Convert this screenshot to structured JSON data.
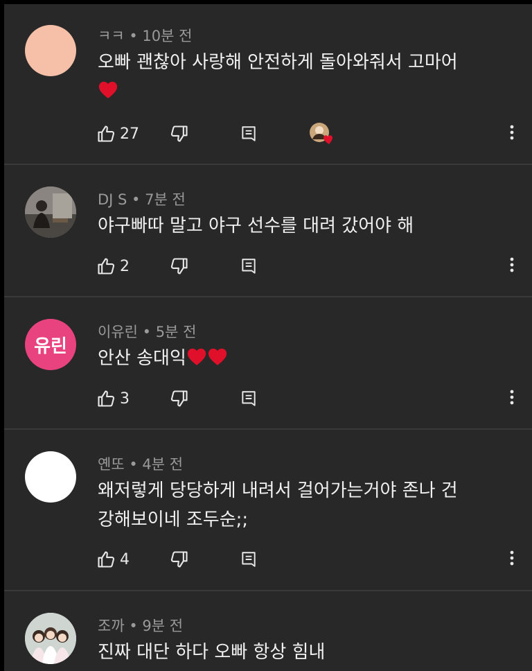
{
  "comments": [
    {
      "author": "ㅋㅋ",
      "time": "10분 전",
      "text": "오빠 괜찮아 사랑해 안전하게 돌아와줘서 고마어",
      "emoji": [
        "heart"
      ],
      "likes": "27",
      "avatar": {
        "kind": "solid",
        "color": "#f5bfa8"
      },
      "creator_heart": true
    },
    {
      "author": "DJ S",
      "time": "7분 전",
      "text": "야구빠따 말고 야구 선수를 대려 갔어야 해",
      "emoji": [],
      "likes": "2",
      "avatar": {
        "kind": "photo"
      },
      "creator_heart": false
    },
    {
      "author": "이유린",
      "time": "5분 전",
      "text": "안산 송대익",
      "emoji": [
        "heart",
        "heart"
      ],
      "likes": "3",
      "avatar": {
        "kind": "initials",
        "initials": "유린",
        "color": "#e8437f"
      },
      "creator_heart": false
    },
    {
      "author": "옌또",
      "time": "4분 전",
      "text": "왜저렇게 당당하게 내려서 걸어가는거야 존나 건강해보이네 조두순;;",
      "emoji": [],
      "likes": "4",
      "avatar": {
        "kind": "solid",
        "color": "#ffffff"
      },
      "creator_heart": false
    },
    {
      "author": "조까",
      "time": "9분 전",
      "text": "진짜 대단 하다 오빠 항상 힘내",
      "emoji": [],
      "likes": "",
      "avatar": {
        "kind": "photo"
      },
      "creator_heart": false
    }
  ],
  "meta_separator": " • ",
  "icons": {
    "like": "thumb-up-icon",
    "dislike": "thumb-down-icon",
    "reply": "reply-icon",
    "more": "more-vert-icon",
    "heart": "heart-icon"
  },
  "colors": {
    "background": "#282828",
    "divider": "#3a3a3a",
    "author": "#9a9a9a",
    "text": "#f1f1f1",
    "heart": "#e0102a"
  }
}
